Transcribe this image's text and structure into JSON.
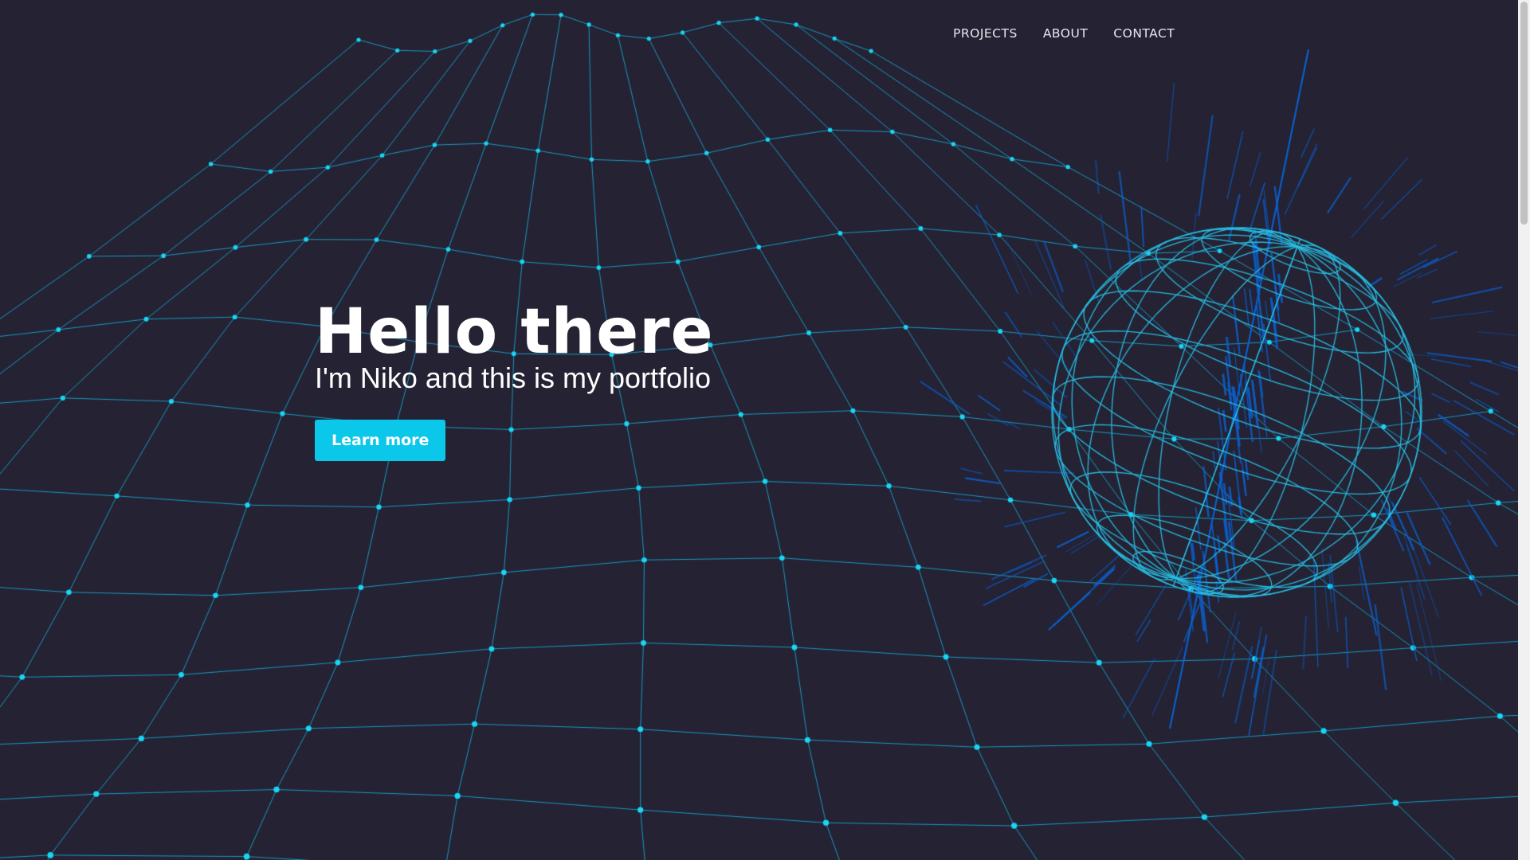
{
  "nav": {
    "items": [
      {
        "label": "PROJECTS"
      },
      {
        "label": "ABOUT"
      },
      {
        "label": "CONTACT"
      }
    ]
  },
  "hero": {
    "title": "Hello there",
    "subtitle": "I'm Niko and this is my portfolio",
    "cta_label": "Learn more"
  },
  "colors": {
    "background": "#242233",
    "accent": "#0bc7ea",
    "grid_line": "#1aa6cf",
    "grid_node": "#18d6f5",
    "sphere_line": "#28c3e8",
    "spikes": "#0a63d6"
  },
  "decor": {
    "background_graphic": "wireframe-grid",
    "hero_graphic": "wireframe-sphere"
  }
}
